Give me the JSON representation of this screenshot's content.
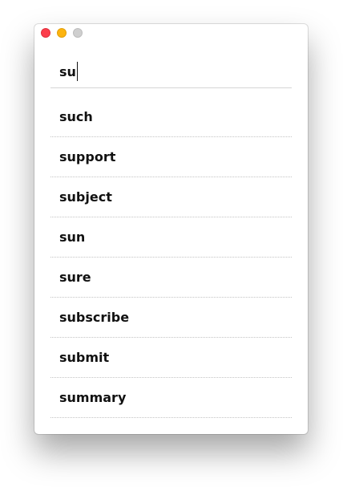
{
  "search": {
    "value": "su"
  },
  "suggestions": [
    {
      "label": "such"
    },
    {
      "label": "support"
    },
    {
      "label": "subject"
    },
    {
      "label": "sun"
    },
    {
      "label": "sure"
    },
    {
      "label": "subscribe"
    },
    {
      "label": "submit"
    },
    {
      "label": "summary"
    }
  ],
  "colors": {
    "close": "#fc3d4b",
    "minimize": "#fcb40f",
    "zoom": "#cfcfcf"
  }
}
